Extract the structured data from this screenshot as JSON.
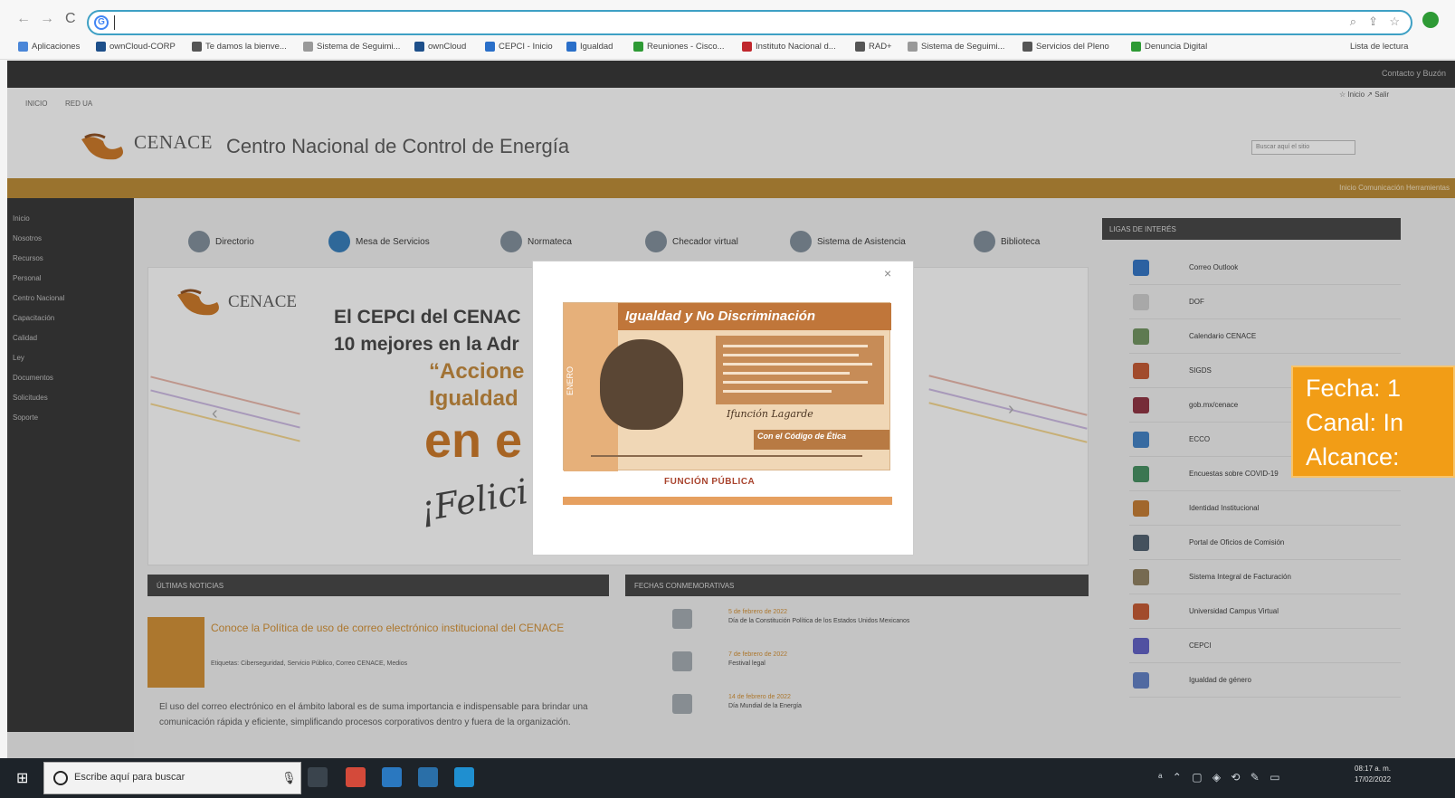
{
  "browser": {
    "nav_back": "←",
    "nav_forward": "→",
    "nav_reload": "C",
    "address_icon": "G",
    "address_value": "",
    "bookmarks": [
      {
        "label": "Aplicaciones",
        "color": "#4a86d8"
      },
      {
        "label": "ownCloud-CORP",
        "color": "#1d4f8a"
      },
      {
        "label": "Te damos la bienve...",
        "color": "#555555"
      },
      {
        "label": "Sistema de Seguimi...",
        "color": "#999999"
      },
      {
        "label": "ownCloud",
        "color": "#1d4f8a"
      },
      {
        "label": "CEPCI - Inicio",
        "color": "#2a6fc9"
      },
      {
        "label": "Igualdad",
        "color": "#2a6fc9"
      },
      {
        "label": "Reuniones - Cisco...",
        "color": "#2e9a35"
      },
      {
        "label": "Instituto Nacional d...",
        "color": "#c0272d"
      },
      {
        "label": "RAD+",
        "color": "#555555"
      },
      {
        "label": "Sistema de Seguimi...",
        "color": "#999999"
      },
      {
        "label": "Servicios del Pleno",
        "color": "#555555"
      },
      {
        "label": "Denuncia Digital",
        "color": "#2e9a35"
      }
    ],
    "reading_list": "Lista de lectura"
  },
  "site": {
    "top_strip_text": "Contacto y Buzón",
    "small_nav": [
      "INICIO",
      "RED UA"
    ],
    "logo_text": "CENACE",
    "title": "Centro Nacional de Control de Energía",
    "top_links": "☆ Inicio  ↗ Salir",
    "search_placeholder": "Buscar aquí el sitio",
    "gold_bar_right": "Inicio  Comunicación  Herramientas",
    "sidebar": [
      "Inicio",
      "Nosotros",
      "Recursos",
      "Personal",
      "Centro Nacional",
      "Capacitación",
      "Calidad",
      "Ley",
      "Documentos",
      "Solicitudes",
      "Soporte"
    ],
    "quick_links": [
      {
        "label": "Directorio",
        "color": "#7b8a97"
      },
      {
        "label": "Mesa de Servicios",
        "color": "#2f78b7"
      },
      {
        "label": "Normateca",
        "color": "#7b8a97"
      },
      {
        "label": "Checador virtual",
        "color": "#7b8a97"
      },
      {
        "label": "Sistema de Asistencia",
        "color": "#7b8a97"
      },
      {
        "label": "Biblioteca",
        "color": "#7b8a97"
      }
    ],
    "banner": {
      "logo_text": "CENACE",
      "headline_1": "El CEPCI del CENAC",
      "headline_2": "10 mejores en la Adr",
      "quote_1": "“Accione",
      "quote_2": "Igualdad",
      "big": "en e",
      "felic": "¡Felici"
    },
    "news_head": "ÚLTIMAS NOTICIAS",
    "news_title": "Conoce la Política de uso de correo electrónico institucional del CENACE",
    "news_meta": "Etiquetas: Ciberseguridad, Servicio Público, Correo CENACE, Medios",
    "news_body": "El uso del correo electrónico en el ámbito laboral es de suma importancia e indispensable para brindar una comunicación rápida y eficiente, simplificando procesos corporativos dentro y fuera de la organización.",
    "events_head": "FECHAS CONMEMORATIVAS",
    "events": [
      {
        "date": "5 de febrero de 2022",
        "title": "Día de la Constitución Política de los Estados Unidos Mexicanos"
      },
      {
        "date": "7 de febrero de 2022",
        "title": "Festival legal"
      },
      {
        "date": "14 de febrero de 2022",
        "title": "Día Mundial de la Energía"
      }
    ],
    "links_head": "LIGAS DE INTERÉS",
    "links": [
      {
        "label": "Correo Outlook",
        "color": "#2b6fc0"
      },
      {
        "label": "DOF",
        "color": "#c9c9c9"
      },
      {
        "label": "Calendario CENACE",
        "color": "#6b8f5a"
      },
      {
        "label": "SIGDS",
        "color": "#c0532b"
      },
      {
        "label": "gob.mx/cenace",
        "color": "#8a2b3a"
      },
      {
        "label": "ECCO",
        "color": "#3a7cc0"
      },
      {
        "label": "Encuestas sobre COVID-19",
        "color": "#3e8a5a"
      },
      {
        "label": "Identidad Institucional",
        "color": "#c0772b"
      },
      {
        "label": "Portal de Oficios de Comisión",
        "color": "#4a5a6a"
      },
      {
        "label": "Sistema Integral de Facturación",
        "color": "#8a7a5a"
      },
      {
        "label": "Universidad Campus Virtual",
        "color": "#c0532b"
      },
      {
        "label": "CEPCI",
        "color": "#5a5ac0"
      },
      {
        "label": "Igualdad de género",
        "color": "#5a7ac0"
      }
    ]
  },
  "modal": {
    "close": "×",
    "poster_title": "Igualdad y No Discriminación",
    "poster_side": "ENERO",
    "poster_sig": "Ifunción Lagarde",
    "poster_code": "Con el Código de Ética",
    "funcion_publica": "FUNCIÓN PÚBLICA"
  },
  "stamp": {
    "line1": "Fecha: 1",
    "line2": "Canal: In",
    "line3": "Alcance:"
  },
  "taskbar": {
    "start": "⊞",
    "search_text": "Escribe aquí para buscar",
    "mic": "🎙",
    "apps": [
      {
        "name": "task-view",
        "color": "#3a444d"
      },
      {
        "name": "chrome",
        "color": "#d44a3a"
      },
      {
        "name": "edge",
        "color": "#2a78c0"
      },
      {
        "name": "store",
        "color": "#2a6fa8"
      },
      {
        "name": "mail",
        "color": "#1f8fd0"
      }
    ],
    "tray": "ᵃ ⌃ ▢ ◈ ⟲ ✎ ▭",
    "time": "08:17 a. m.",
    "date": "17/02/2022"
  }
}
